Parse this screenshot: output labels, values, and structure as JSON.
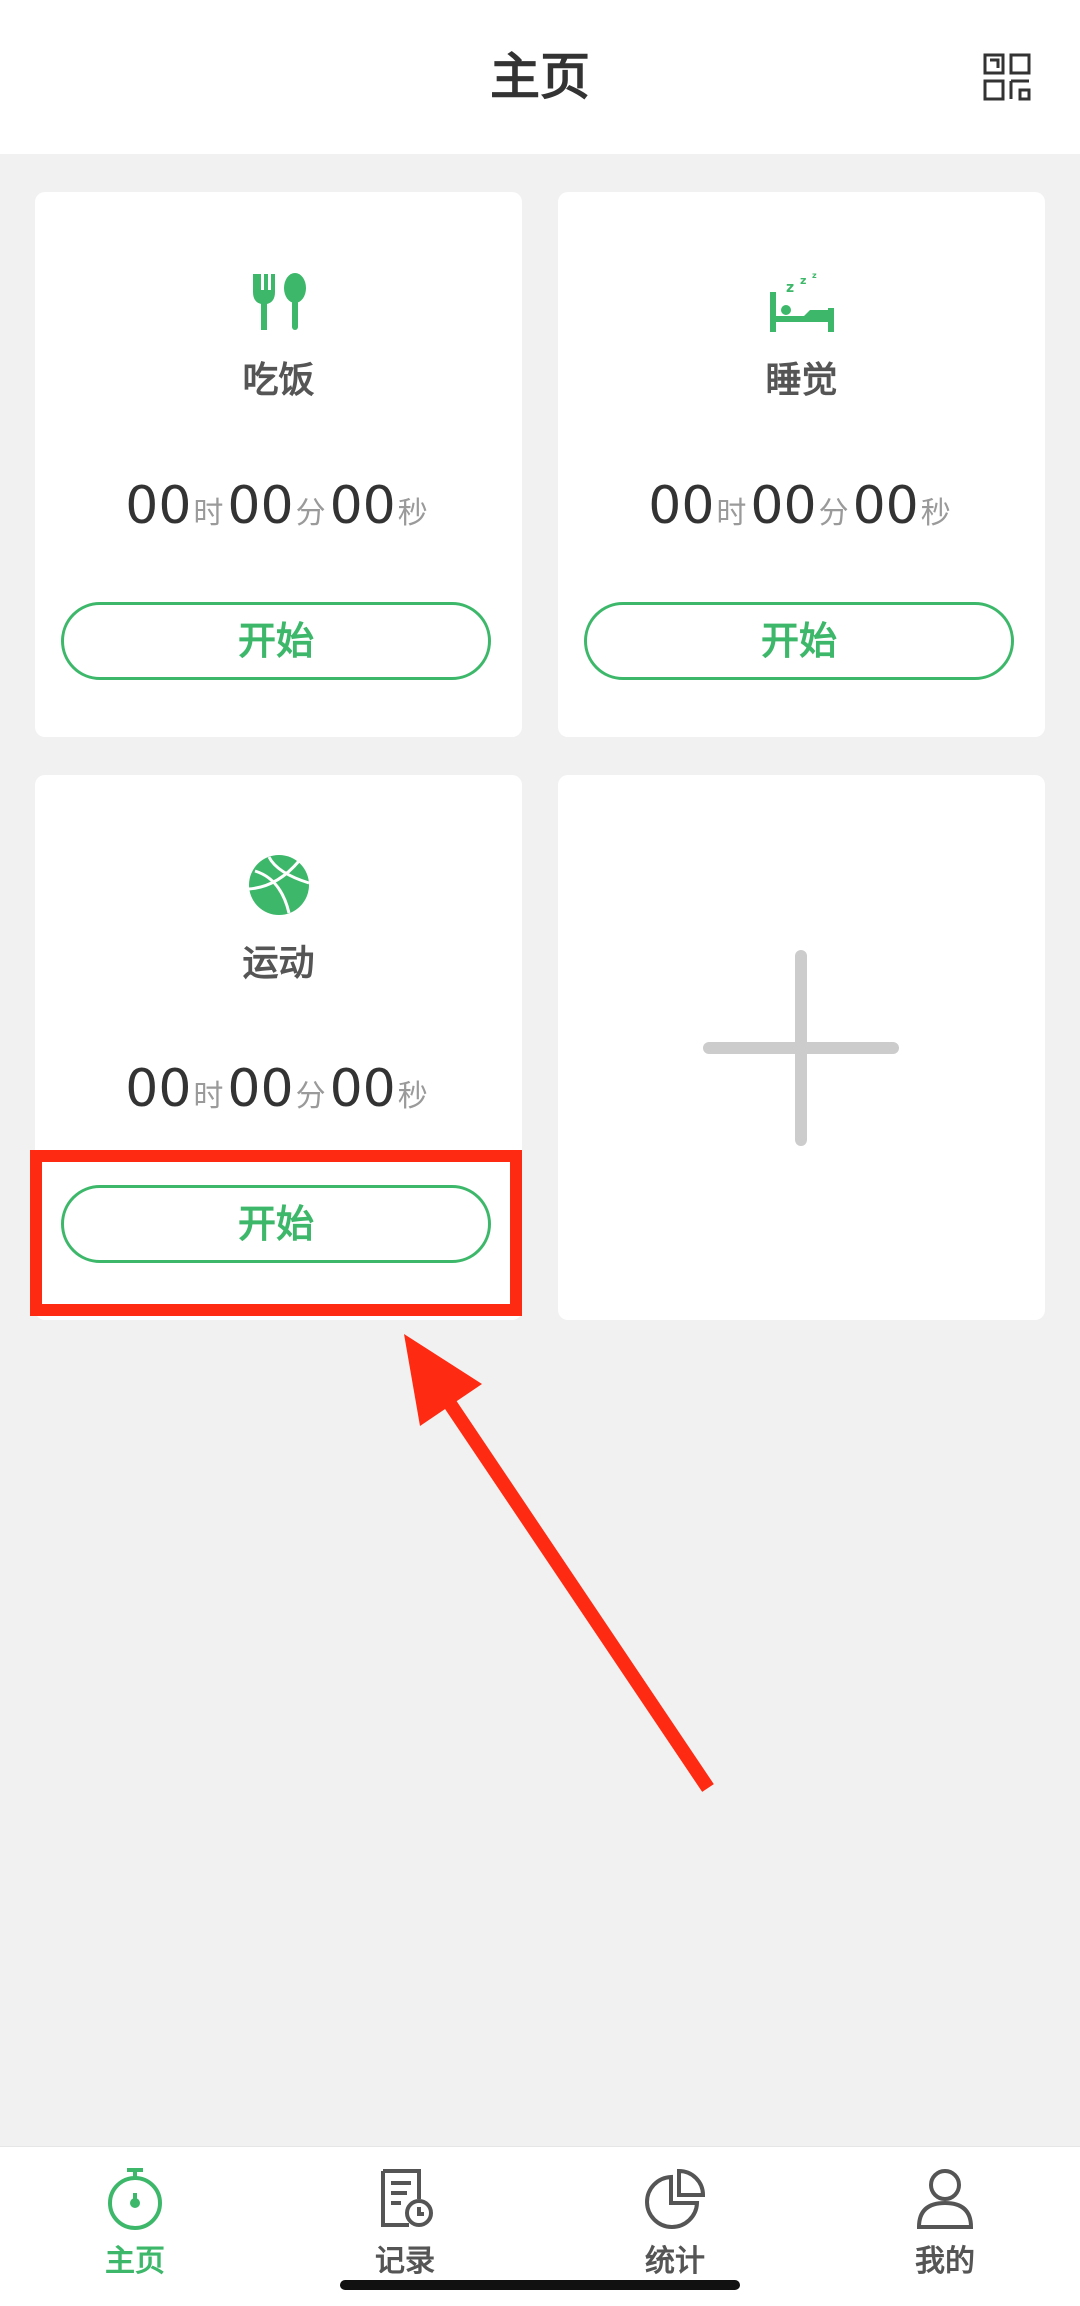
{
  "header": {
    "title": "主页",
    "scan_icon": "scan-grid-icon"
  },
  "units": {
    "hour": "时",
    "minute": "分",
    "second": "秒"
  },
  "cards": [
    {
      "label": "吃饭",
      "icon": "fork-spoon-icon",
      "hours": "00",
      "minutes": "00",
      "seconds": "00",
      "button": "开始"
    },
    {
      "label": "睡觉",
      "icon": "sleeping-bed-icon",
      "hours": "00",
      "minutes": "00",
      "seconds": "00",
      "button": "开始"
    },
    {
      "label": "运动",
      "icon": "basketball-icon",
      "hours": "00",
      "minutes": "00",
      "seconds": "00",
      "button": "开始"
    }
  ],
  "add_card": {
    "icon": "plus-icon"
  },
  "annotation": {
    "color": "#ff2a12"
  },
  "tabs": [
    {
      "label": "主页",
      "icon": "stopwatch-icon",
      "active": true
    },
    {
      "label": "记录",
      "icon": "record-list-icon",
      "active": false
    },
    {
      "label": "统计",
      "icon": "pie-chart-icon",
      "active": false
    },
    {
      "label": "我的",
      "icon": "person-icon",
      "active": false
    }
  ],
  "colors": {
    "accent": "#3db86a",
    "background": "#f1f1f1",
    "placeholder": "#cccccc"
  }
}
